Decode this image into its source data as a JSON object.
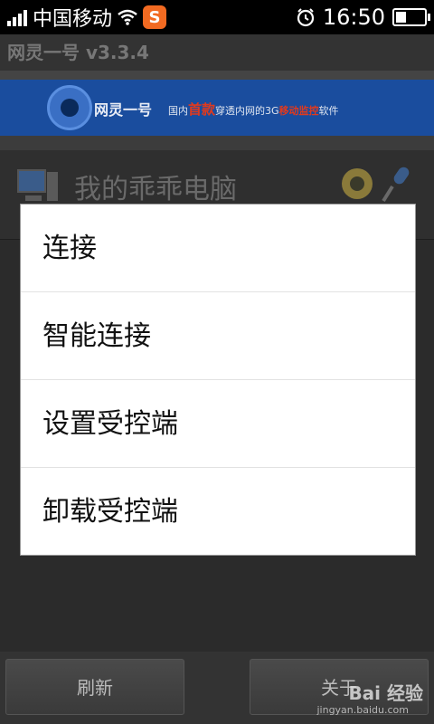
{
  "status_bar": {
    "carrier": "中国移动",
    "notification_app": "S",
    "time": "16:50",
    "battery_level": 0.35
  },
  "app": {
    "title": "网灵一号 v3.3.4",
    "banner_name": "网灵一号",
    "banner_slogan_pre": "国内",
    "banner_slogan_highlight": "首款",
    "banner_slogan_mid": "穿透内网的3G",
    "banner_slogan_highlight2": "移动监控",
    "banner_slogan_post": "软件"
  },
  "device": {
    "name": "我的乖乖电脑"
  },
  "dialog": {
    "items": [
      {
        "label": "连接"
      },
      {
        "label": "智能连接"
      },
      {
        "label": "设置受控端"
      },
      {
        "label": "卸载受控端"
      }
    ]
  },
  "bottom_bar": {
    "refresh_label": "刷新",
    "close_label": "关于"
  },
  "watermark": {
    "logo_text": "Bai 经验",
    "url": "jingyan.baidu.com"
  },
  "colors": {
    "banner_blue": "#1a4d9e",
    "highlight_red": "#e03a1e",
    "sogou_orange": "#f26a21"
  }
}
